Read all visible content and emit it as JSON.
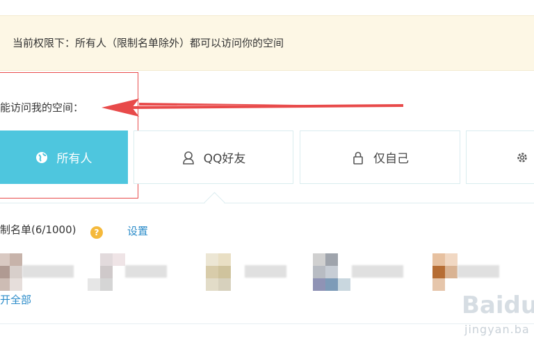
{
  "notice": {
    "text": "当前权限下：所有人（限制名单除外）都可以访问你的空间"
  },
  "prompt": {
    "text": "能访问我的空间："
  },
  "options": [
    {
      "label": "所有人",
      "icon": "globe-icon",
      "active": true
    },
    {
      "label": "QQ好友",
      "icon": "user-icon",
      "active": false
    },
    {
      "label": "仅自己",
      "icon": "lock-icon",
      "active": false
    },
    {
      "label": "",
      "icon": "gear-icon",
      "active": false
    }
  ],
  "block_list": {
    "label": "制名单(6/1000)",
    "help": "?",
    "settings": "设置",
    "expand": "开全部"
  },
  "watermark": {
    "brand": "Baidu",
    "site": "jingyan.ba"
  },
  "colors": {
    "accent": "#4ec6de",
    "link": "#2a8bc9",
    "annotation": "#e84a4a",
    "notice_bg": "#fdf7e5",
    "help": "#f5b93b"
  }
}
